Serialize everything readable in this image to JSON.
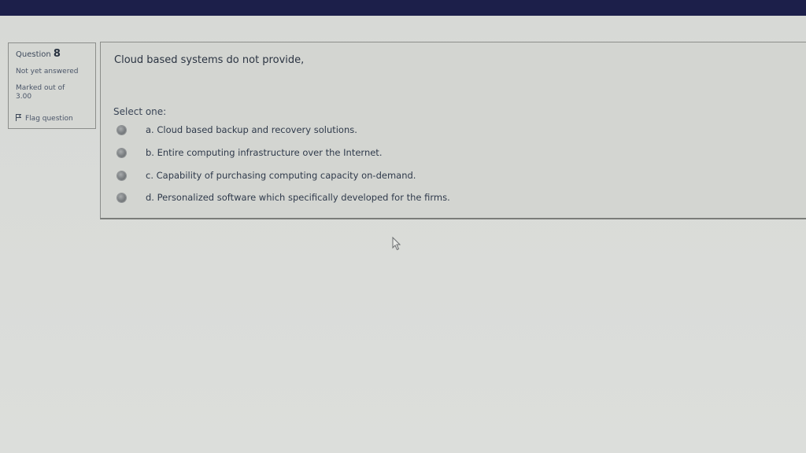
{
  "question_info": {
    "number_prefix": "Question",
    "number": "8",
    "state": "Not yet answered",
    "grade_line1": "Marked out of",
    "grade_line2": "3.00",
    "flag_label": "Flag question"
  },
  "question": {
    "text": "Cloud based systems do not provide,",
    "prompt": "Select one:",
    "options": [
      {
        "label": "a. Cloud based backup and recovery solutions."
      },
      {
        "label": "b. Entire computing infrastructure over the Internet."
      },
      {
        "label": "c. Capability of purchasing computing capacity on-demand."
      },
      {
        "label": "d. Personalized software which specifically developed for the firms."
      }
    ]
  },
  "icons": {
    "flag": "flag-icon",
    "radio": "radio-button",
    "cursor": "mouse-pointer-icon"
  },
  "colors": {
    "topbar": "#1c1f4a",
    "page_background": "#d7d9d6"
  }
}
